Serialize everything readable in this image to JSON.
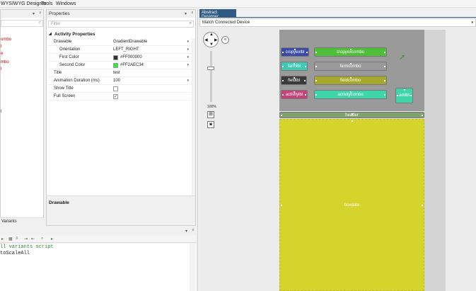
{
  "menubar": {
    "items": [
      "WYSIWYG Designer",
      "Tools",
      "Windows"
    ]
  },
  "left_panel": {
    "pin": "p",
    "tree": [
      {
        "text": "ombo",
        "color": "#cc0000"
      },
      {
        "text": "l",
        "color": "#cc0000"
      },
      {
        "text": "e",
        "color": "#cc0000"
      },
      {
        "text": "mbo",
        "color": "#cc0000"
      },
      {
        "text": "l",
        "color": "#cc0000"
      },
      {
        "text": "l",
        "color": "#1e1e1e"
      }
    ],
    "bottom_tab": "Variants"
  },
  "properties": {
    "title": "Properties",
    "filter_placeholder": "Filter",
    "section": "Activity Properties",
    "rows": [
      {
        "key": "Drawable",
        "value": "GradientDrawable",
        "dropdown": true,
        "indent": 1
      },
      {
        "key": "Orientation",
        "value": "LEFT_RIGHT",
        "dropdown": true,
        "indent": 2
      },
      {
        "key": "First Color",
        "value": "#FF000000",
        "swatch": "#333333",
        "dropdown": true,
        "indent": 2
      },
      {
        "key": "Second Color",
        "value": "#FF2AEC34",
        "swatch": "#2aec34",
        "dropdown": true,
        "indent": 2
      },
      {
        "key": "Title",
        "value": "test",
        "indent": 1
      },
      {
        "key": "Animation Duration (ms)",
        "value": "100",
        "dropdown": true,
        "indent": 1
      },
      {
        "key": "Show Title",
        "check": false,
        "indent": 1
      },
      {
        "key": "Full Screen",
        "check": true,
        "indent": 1
      }
    ],
    "description_title": "Drawable"
  },
  "code": {
    "lines": [
      {
        "text": "ll variants script",
        "color": "#2d8a2d"
      },
      {
        "text": "toScaleAll",
        "color": "#1e1e1e"
      }
    ]
  },
  "designer": {
    "tab_label": "Abstract Designer",
    "device": "Match Connected Device",
    "zoom": "100%",
    "views": [
      {
        "name": "cropyexlbl",
        "label": "cropyexlbl",
        "color": "#3b49a8"
      },
      {
        "name": "cropyexcombo",
        "label": "cropyexcombo",
        "color": "#4fbf3a"
      },
      {
        "name": "farmlbl",
        "label": "farmlbl",
        "color": "#3ec9b0"
      },
      {
        "name": "farmcombo",
        "label": "farmcombo",
        "color": "#9a9a9a"
      },
      {
        "name": "fieldlbl",
        "label": "fieldlbl",
        "color": "#3a3a3a"
      },
      {
        "name": "fieldcombo",
        "label": "fieldcombo",
        "color": "#a6a82e"
      },
      {
        "name": "activitylbl",
        "label": "activitylbl",
        "color": "#c8427a"
      },
      {
        "name": "activitycombo",
        "label": "activitycombo",
        "color": "#3ed6a8"
      },
      {
        "name": "addbtn",
        "label": "addbt",
        "color": "#3ed6a8"
      },
      {
        "name": "header",
        "label": "header",
        "color": "#7ea36e"
      },
      {
        "name": "panel",
        "label": "boxdata",
        "color": "#d4d42c"
      }
    ]
  }
}
